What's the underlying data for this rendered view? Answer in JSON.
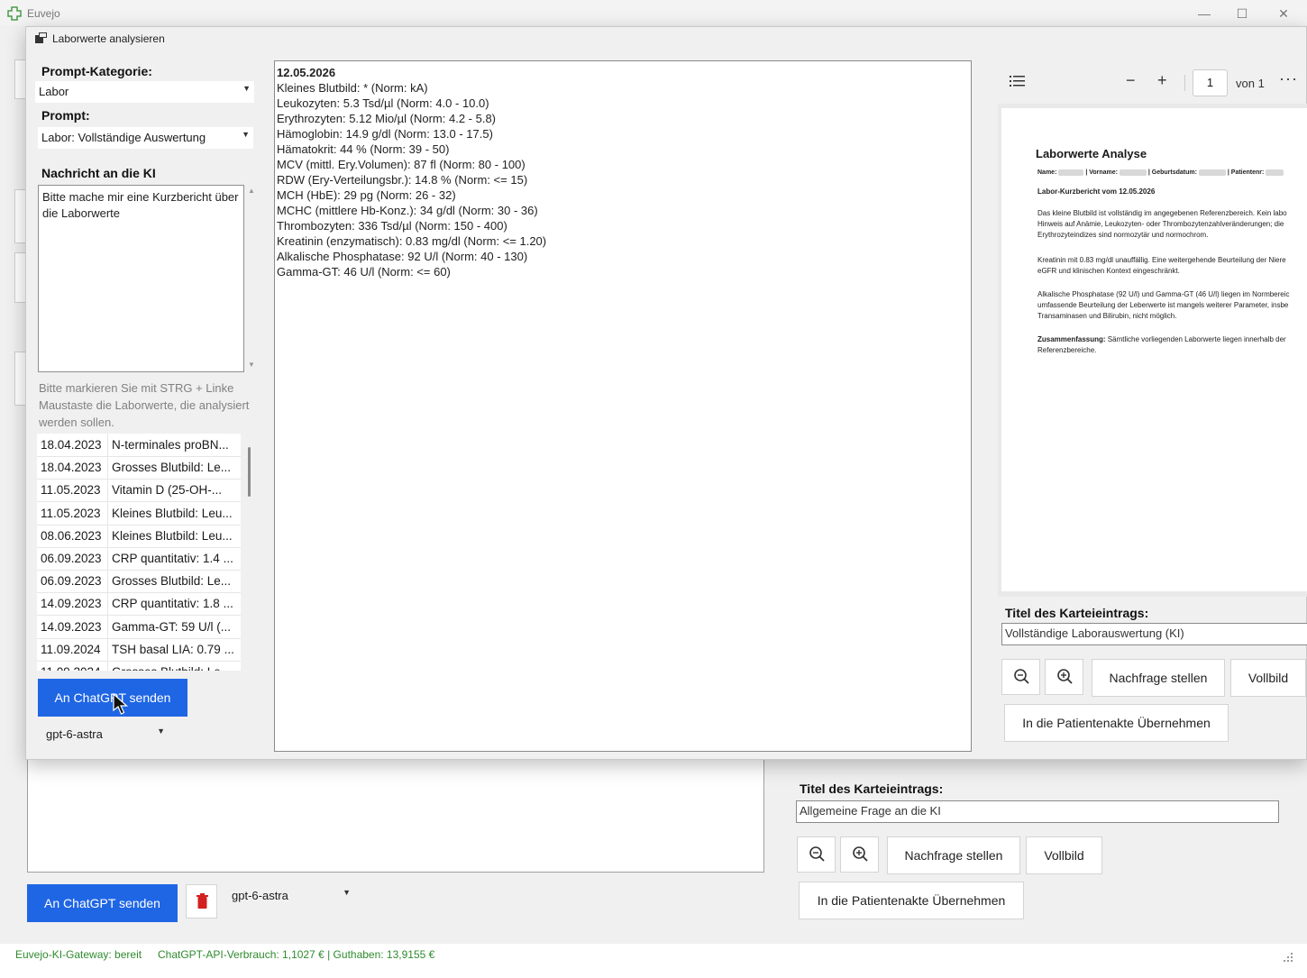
{
  "app": {
    "title": "Euvejo",
    "minimize": "—",
    "maximize": "☐",
    "close": "✕"
  },
  "dialog": {
    "title": "Laborwerte analysieren",
    "prompt_category_label": "Prompt-Kategorie:",
    "prompt_category_value": "Labor",
    "prompt_label": "Prompt:",
    "prompt_value": "Labor: Vollständige Auswertung",
    "message_label": "Nachricht an die KI",
    "message_text": "Bitte mache mir eine Kurzbericht über die Laborwerte",
    "hint": "Bitte markieren Sie mit STRG + Linke Maustaste die Laborwerte, die analysiert werden sollen.",
    "lab_entries": [
      {
        "date": "18.04.2023",
        "text": "N-terminales proBN..."
      },
      {
        "date": "18.04.2023",
        "text": "Grosses Blutbild: Le..."
      },
      {
        "date": "11.05.2023",
        "text": "Vitamin D (25-OH-..."
      },
      {
        "date": "11.05.2023",
        "text": "Kleines Blutbild: Leu..."
      },
      {
        "date": "08.06.2023",
        "text": "Kleines Blutbild: Leu..."
      },
      {
        "date": "06.09.2023",
        "text": "CRP quantitativ: 1.4 ..."
      },
      {
        "date": "06.09.2023",
        "text": "Grosses Blutbild: Le..."
      },
      {
        "date": "14.09.2023",
        "text": "CRP quantitativ: 1.8 ..."
      },
      {
        "date": "14.09.2023",
        "text": "Gamma-GT: 59 U/l (..."
      },
      {
        "date": "11.09.2024",
        "text": "TSH basal LIA: 0.79 ..."
      },
      {
        "date": "11.09.2024",
        "text": "Grosses Blutbild: Le..."
      }
    ],
    "send_button": "An ChatGPT senden",
    "model_value": "gpt-6-astra",
    "results_date": "12.05.2026",
    "results_lines": [
      "Kleines Blutbild: * (Norm: kA)",
      "Leukozyten: 5.3 Tsd/µl (Norm: 4.0 - 10.0)",
      "Erythrozyten: 5.12 Mio/µl (Norm: 4.2 - 5.8)",
      "Hämoglobin: 14.9 g/dl (Norm: 13.0 - 17.5)",
      "Hämatokrit: 44 % (Norm: 39 - 50)",
      "MCV (mittl. Ery.Volumen): 87 fl (Norm: 80 - 100)",
      "RDW (Ery-Verteilungsbr.): 14.8 % (Norm: <= 15)",
      "MCH (HbE): 29 pg (Norm: 26 - 32)",
      "MCHC (mittlere Hb-Konz.): 34 g/dl (Norm: 30 - 36)",
      "Thrombozyten: 336 Tsd/µl (Norm: 150 - 400)",
      "Kreatinin (enzymatisch): 0.83 mg/dl (Norm: <= 1.20)",
      "Alkalische Phosphatase: 92 U/l (Norm: 40 - 130)",
      "Gamma-GT: 46 U/l (Norm: <= 60)"
    ],
    "pdf": {
      "page_number": "1",
      "page_of": "von 1",
      "heading": "Laborwerte Analyse",
      "meta_name": "Name:",
      "meta_vorname": "| Vorname:",
      "meta_geb": "| Geburtsdatum:",
      "meta_pat": "| Patientenr:",
      "subheading": "Labor-Kurzbericht vom 12.05.2026",
      "p1_l1": "Das kleine Blutbild ist vollständig im angegebenen Referenzbereich. Kein labo",
      "p1_l2": "Hinweis auf Anämie, Leukozyten- oder Thrombozytenzahlveränderungen; die",
      "p1_l3": "Erythrozyteindizes sind normozytär und normochrom.",
      "p2_l1": "Kreatinin mit 0.83 mg/dl unauffällig. Eine weitergehende Beurteilung der Niere",
      "p2_l2": "eGFR und klinischen Kontext eingeschränkt.",
      "p3_l1": "Alkalische Phosphatase (92 U/l) und Gamma-GT (46 U/l) liegen im Normbereic",
      "p3_l2": "umfassende Beurteilung der Leberwerte ist mangels weiterer Parameter, insbe",
      "p3_l3": "Transaminasen und Bilirubin, nicht möglich.",
      "p4_bold": "Zusammenfassung:",
      "p4_l1": " Sämtliche vorliegenden Laborwerte liegen innerhalb der",
      "p4_l2": "Referenzbereiche."
    },
    "entry_title_label": "Titel des Karteieintrags:",
    "entry_title_value": "Vollständige Laborauswertung (KI)",
    "followup_button": "Nachfrage stellen",
    "fullscreen_button": "Vollbild",
    "apply_button": "In die Patientenakte Übernehmen"
  },
  "main": {
    "entry_title_label": "Titel des Karteieintrags:",
    "entry_title_value": "Allgemeine Frage an die KI",
    "followup_button": "Nachfrage stellen",
    "fullscreen_button": "Vollbild",
    "apply_button": "In die Patientenakte Übernehmen",
    "send_button": "An ChatGPT senden",
    "model_value": "gpt-6-astra"
  },
  "status": {
    "gateway": "Euvejo-KI-Gateway: bereit",
    "usage": "ChatGPT-API-Verbrauch: 1,1027 € | Guthaben: 13,9155 €"
  },
  "colors": {
    "accent": "#1f66e5",
    "status_green": "#2e8b2e",
    "delete_red": "#d32020"
  }
}
